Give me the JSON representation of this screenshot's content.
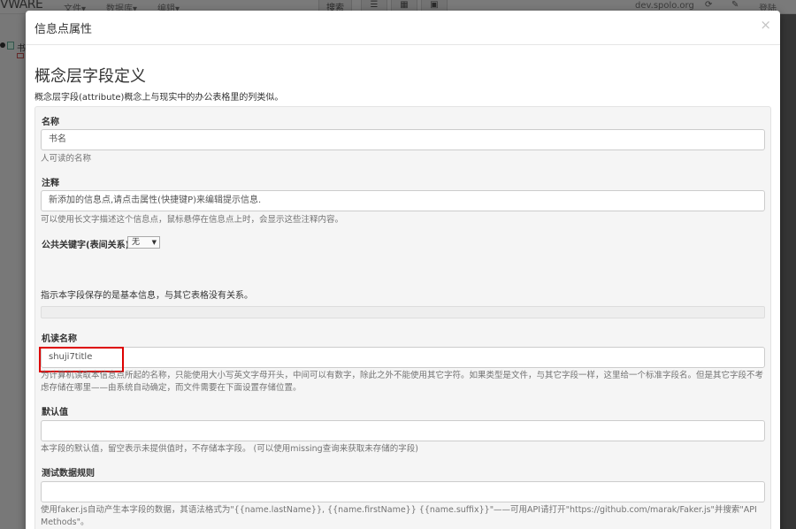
{
  "navbar": {
    "brand": "VWARE",
    "menus": [
      "文件▾",
      "数据库▾",
      "编辑▾"
    ],
    "search_label": "搜索",
    "server": "dev.spolo.org",
    "login": "登陆"
  },
  "sidebar": {
    "item_label": "书"
  },
  "modal": {
    "title": "信息点属性",
    "close": "×",
    "section_title": "概念层字段定义",
    "section_desc": "概念层字段(attribute)概念上与现实中的办公表格里的列类似。"
  },
  "form": {
    "name": {
      "label": "名称",
      "value": "书名",
      "help": "人可读的名称"
    },
    "comment": {
      "label": "注释",
      "value": "新添加的信息点,请点击属性(快捷键P)来编辑提示信息.",
      "help": "可以使用长文字描述这个信息点，鼠标悬停在信息点上时，会显示这些注释内容。"
    },
    "public_key": {
      "label": "公共关键字(表间关系)",
      "selected": "无",
      "help": "指示本字段保存的是基本信息，与其它表格没有关系。"
    },
    "machine_name": {
      "label": "机读名称",
      "value": "shuji7title",
      "help": "为计算机读取本信息点所起的名称，只能使用大小写英文字母开头，中间可以有数字，除此之外不能使用其它字符。如果类型是文件，与其它字段一样，这里给一个标准字段名。但是其它字段不考虑存储在哪里——由系统自动确定，而文件需要在下面设置存储位置。"
    },
    "default_value": {
      "label": "默认值",
      "value": "",
      "help": "本字段的默认值，留空表示未提供值时，不存储本字段。 (可以使用missing查询来获取未存储的字段)"
    },
    "test_rule": {
      "label": "测试数据规则",
      "value": "",
      "help": "使用faker.js自动产生本字段的数据，其语法格式为\"{{name.lastName}}, {{name.firstName}} {{name.suffix}}\"——可用API请打开\"https://github.com/marak/Faker.js\"并搜索\"API Methods\"。"
    }
  },
  "colors": {
    "highlight": "#dd0000",
    "overlay": "rgba(0,0,0,0.5)"
  }
}
